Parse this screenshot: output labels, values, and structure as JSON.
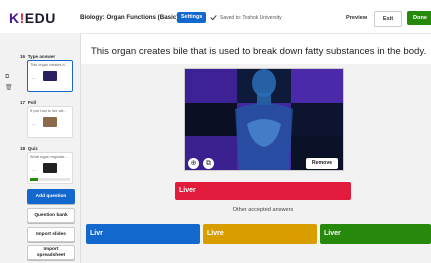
{
  "header": {
    "logo_text": "K!EDU",
    "title": "Biology: Organ Functions (Basic)",
    "settings_label": "Settings",
    "saved_text": "Saved to: Toshok University",
    "preview_label": "Preview",
    "exit_label": "Exit",
    "done_label": "Done"
  },
  "sidebar": {
    "slides": [
      {
        "number": "16",
        "type": "Type answer",
        "preview": "This organ creates b...",
        "active": true
      },
      {
        "number": "17",
        "type": "Poll",
        "preview": "If you had to live wit...",
        "active": false
      },
      {
        "number": "18",
        "type": "Quiz",
        "preview": "What organ regulate...",
        "active": false
      }
    ],
    "add_question_label": "Add question",
    "question_bank_label": "Question bank",
    "import_slides_label": "Import slides",
    "import_spreadsheet_line1": "Import",
    "import_spreadsheet_line2": "spreadsheet"
  },
  "main": {
    "question": "This organ creates bile that is used to break down fatty substances in the body.",
    "remove_label": "Remove",
    "answer": "Liver",
    "other_label": "Other accepted answers",
    "alternatives": [
      "Livr",
      "Livre",
      "Liver"
    ]
  },
  "colors": {
    "brand_blue": "#1368ce",
    "red": "#e21b3c",
    "blue": "#1368ce",
    "yellow": "#d89e00",
    "green": "#26890c",
    "purple": "#46178f"
  }
}
